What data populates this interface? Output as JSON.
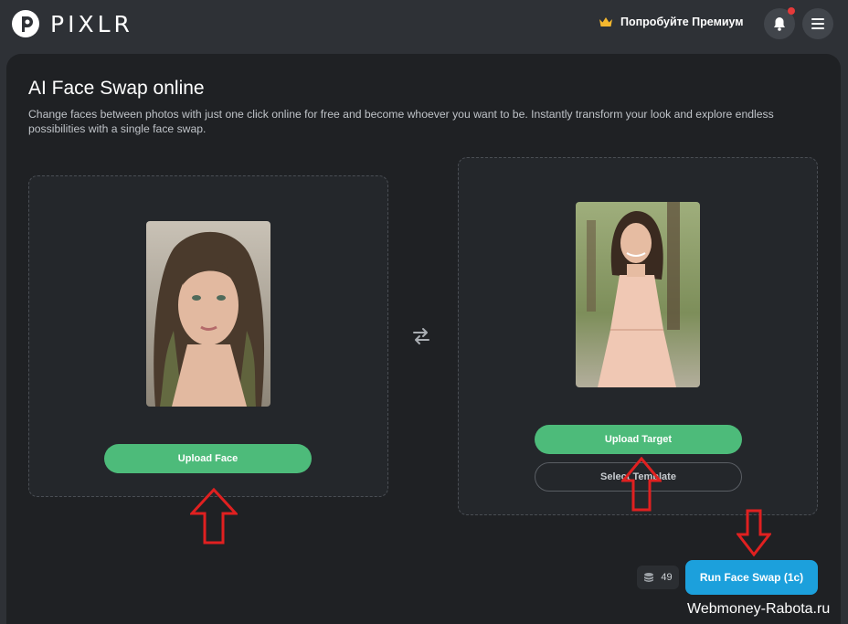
{
  "app": {
    "name": "PIXLR",
    "premium_label": "Попробуйте Премиум"
  },
  "page": {
    "title": "AI Face Swap online",
    "description": "Change faces between photos with just one click online for free and become whoever you want to be. Instantly transform your look and explore endless possibilities with a single face swap."
  },
  "face_panel": {
    "upload_label": "Upload Face"
  },
  "target_panel": {
    "upload_label": "Upload Target",
    "template_label": "Select Template"
  },
  "footer": {
    "credits": "49",
    "run_label": "Run Face Swap (1c)"
  },
  "watermark": "Webmoney-Rabota.ru",
  "colors": {
    "accent_green": "#4dbb7a",
    "accent_blue": "#1ca0dc",
    "annotation_red": "#e02020",
    "notification_dot": "#e53a3a"
  },
  "icons": [
    "pixlr-logo-icon",
    "crown-icon",
    "bell-icon",
    "menu-icon",
    "swap-arrows-icon",
    "coins-icon"
  ]
}
